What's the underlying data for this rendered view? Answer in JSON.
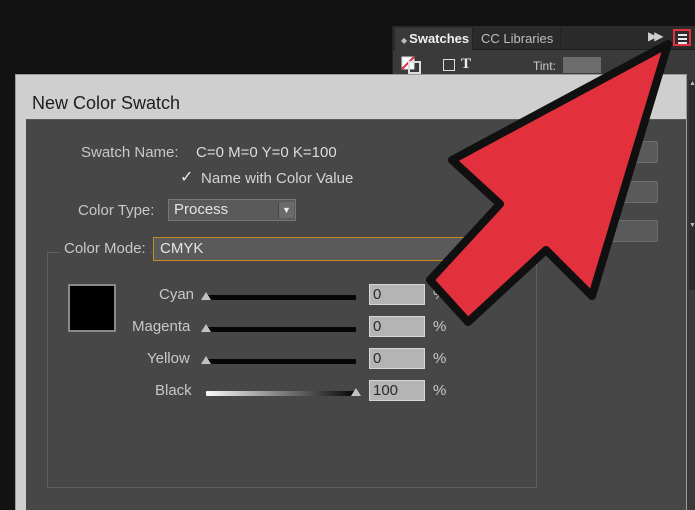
{
  "panel": {
    "tabs": [
      {
        "label": "Swatches"
      },
      {
        "label": "CC Libraries"
      }
    ],
    "tint_label": "Tint:",
    "tint_value": ""
  },
  "dialog": {
    "title": "New Color Swatch",
    "swatch_name_label": "Swatch Name:",
    "swatch_name_value": "C=0 M=0 Y=0 K=100",
    "name_with_value_label": "Name with Color Value",
    "name_with_value_checked": true,
    "color_type_label": "Color Type:",
    "color_type_value": "Process",
    "color_mode_label": "Color Mode:",
    "color_mode_value": "CMYK",
    "preview_color": "#000000",
    "sliders": [
      {
        "label": "Cyan",
        "value": "0",
        "unit": "%",
        "level": 0
      },
      {
        "label": "Magenta",
        "value": "0",
        "unit": "%",
        "level": 0
      },
      {
        "label": "Yellow",
        "value": "0",
        "unit": "%",
        "level": 0
      },
      {
        "label": "Black",
        "value": "100",
        "unit": "%",
        "level": 1
      }
    ]
  },
  "colors": {
    "annotation_arrow": "#e2303d",
    "focus_border": "#c68a1e"
  }
}
